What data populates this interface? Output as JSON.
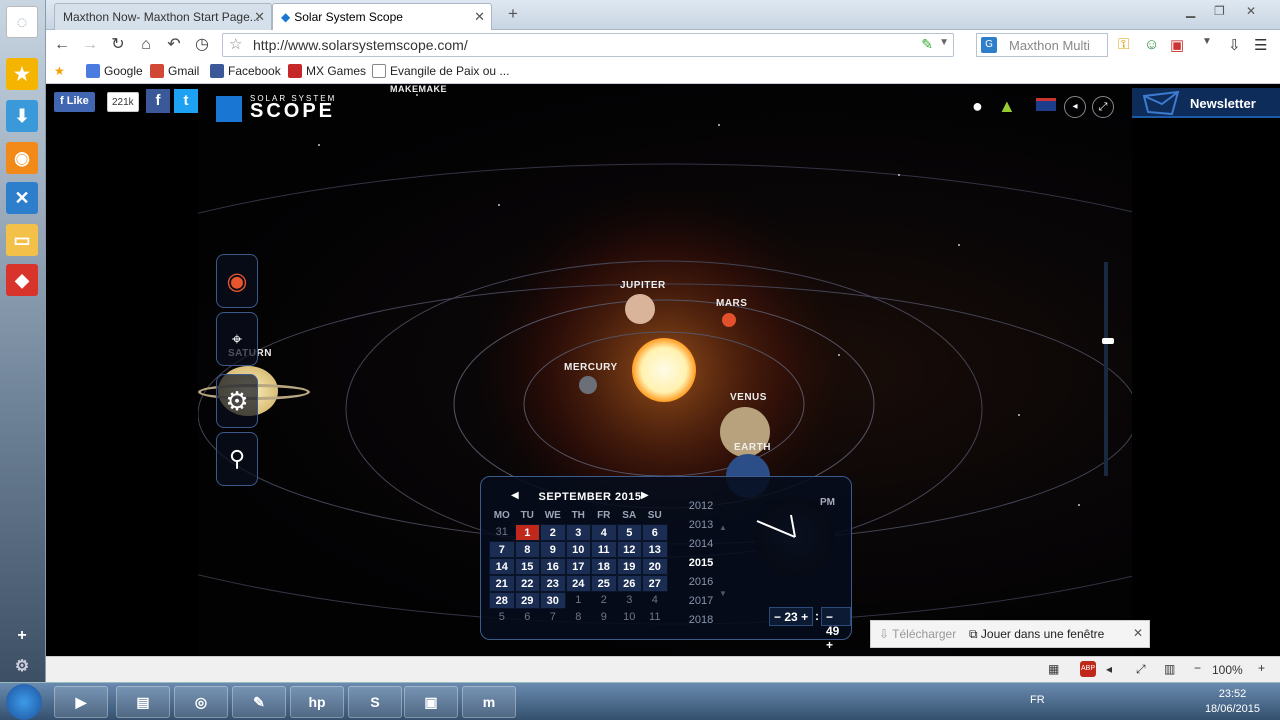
{
  "browser": {
    "tabs": [
      {
        "label": "Maxthon Now- Maxthon Start Page...",
        "active": false
      },
      {
        "label": "Solar System Scope",
        "active": true
      }
    ],
    "new_tab": "+",
    "url": "http://www.solarsystemscope.com/",
    "search_placeholder": "Maxthon Multi",
    "bookmarks": [
      "Google",
      "Gmail",
      "Facebook",
      "MX Games",
      "Evangile de Paix ou ..."
    ],
    "zoom": "100%",
    "status_lang": "FR"
  },
  "site": {
    "fb_like": "Like",
    "fb_count": "221k",
    "logo_top": "SOLAR SYSTEM",
    "logo_bottom": "SCOPE",
    "newsletter": "Newsletter",
    "planets": {
      "makemake": "MAKEMAKE",
      "jupiter": "JUPITER",
      "mars": "MARS",
      "mercury": "MERCURY",
      "venus": "VENUS",
      "earth": "EARTH",
      "saturn": "SATURN"
    }
  },
  "calendar": {
    "month_title": "SEPTEMBER 2015",
    "weekdays": [
      "MO",
      "TU",
      "WE",
      "TH",
      "FR",
      "SA",
      "SU"
    ],
    "weeks": [
      [
        "31",
        "1",
        "2",
        "3",
        "4",
        "5",
        "6"
      ],
      [
        "7",
        "8",
        "9",
        "10",
        "11",
        "12",
        "13"
      ],
      [
        "14",
        "15",
        "16",
        "17",
        "18",
        "19",
        "20"
      ],
      [
        "21",
        "22",
        "23",
        "24",
        "25",
        "26",
        "27"
      ],
      [
        "28",
        "29",
        "30",
        "1",
        "2",
        "3",
        "4"
      ],
      [
        "5",
        "6",
        "7",
        "8",
        "9",
        "10",
        "11"
      ]
    ],
    "selected_day": "1",
    "years": [
      "2012",
      "2013",
      "2014",
      "2015",
      "2016",
      "2017",
      "2018"
    ],
    "current_year": "2015",
    "ampm": "PM",
    "hour": "23",
    "minute": "49",
    "minus": "−",
    "plus": "+",
    "colon": ":"
  },
  "popup": {
    "download": "Télécharger",
    "window": "Jouer dans une fenêtre",
    "close": "✕"
  },
  "taskbar": {
    "time": "23:52",
    "date": "18/06/2015",
    "lang": "FR"
  },
  "colors": {
    "accent": "#1976d2",
    "selected_day": "#c0281c",
    "panel_border": "#3c5a8a"
  }
}
